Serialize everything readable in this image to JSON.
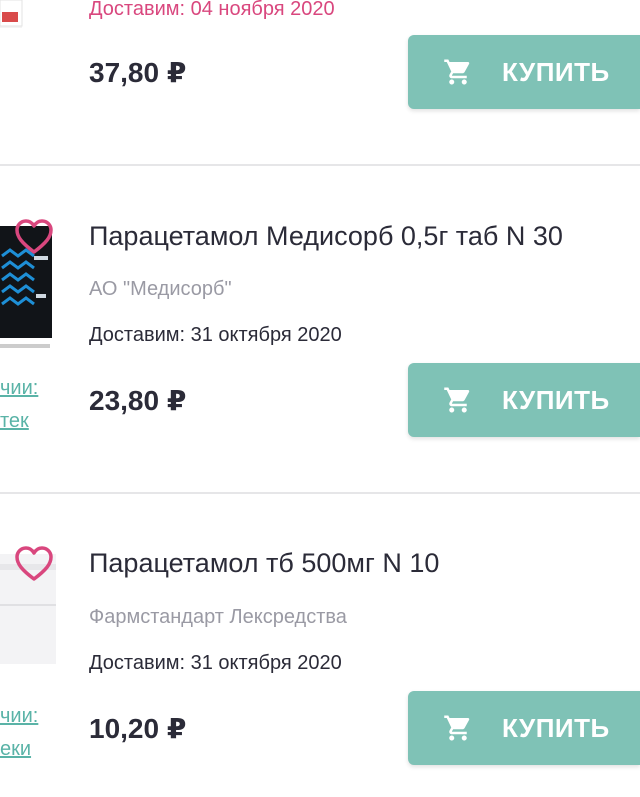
{
  "colors": {
    "accent": "#7fc2b6",
    "heart": "#d9477e",
    "delivery_highlight": "#d9477e",
    "link": "#5ab3a7"
  },
  "products": [
    {
      "title": "",
      "manufacturer": "",
      "delivery": "Доставим: 04 ноября 2020",
      "price": "37,80 ₽",
      "buy_label": "КУПИТЬ",
      "availability_line1": "",
      "availability_line2": ""
    },
    {
      "title": "Парацетамол Медисорб 0,5г таб N 30",
      "manufacturer": "АО \"Медисорб\"",
      "delivery": "Доставим: 31 октября 2020",
      "price": "23,80 ₽",
      "buy_label": "КУПИТЬ",
      "availability_line1": "чии:",
      "availability_line2": "тек"
    },
    {
      "title": "Парацетамол тб 500мг N 10",
      "manufacturer": "Фармстандарт Лексредства",
      "delivery": "Доставим: 31 октября 2020",
      "price": "10,20 ₽",
      "buy_label": "КУПИТЬ",
      "availability_line1": "чии:",
      "availability_line2": "еки"
    }
  ],
  "icons": {
    "favorite": "heart-outline-icon",
    "cart": "shopping-cart-icon"
  }
}
